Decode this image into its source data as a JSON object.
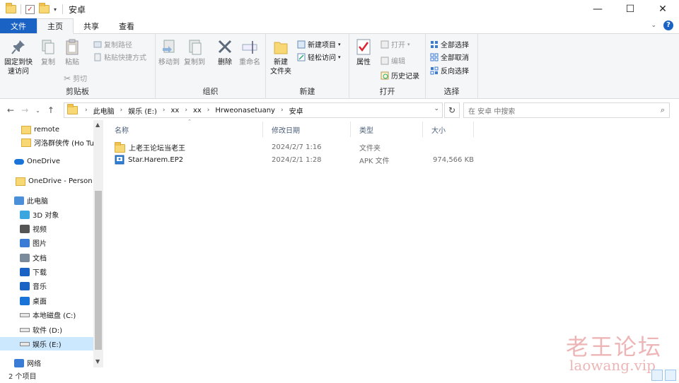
{
  "window": {
    "title": "安卓",
    "controls": {
      "minimize": "—",
      "maximize": "☐",
      "close": "✕"
    }
  },
  "tabs": [
    "文件",
    "主页",
    "共享",
    "查看"
  ],
  "ribbon": {
    "clipboard": {
      "label": "剪贴板",
      "pin": "固定到快\n速访问",
      "copy": "复制",
      "paste": "粘贴",
      "copy_path": "复制路径",
      "paste_shortcut": "粘贴快捷方式",
      "cut": "剪切"
    },
    "organize": {
      "label": "组织",
      "move_to": "移动到",
      "copy_to": "复制到",
      "delete": "删除",
      "rename": "重命名"
    },
    "new": {
      "label": "新建",
      "new_folder": "新建\n文件夹",
      "new_item": "新建项目",
      "easy_access": "轻松访问"
    },
    "open": {
      "label": "打开",
      "properties": "属性",
      "open": "打开",
      "edit": "编辑",
      "history": "历史记录"
    },
    "select": {
      "label": "选择",
      "select_all": "全部选择",
      "select_none": "全部取消",
      "invert": "反向选择"
    }
  },
  "address": {
    "crumbs": [
      "此电脑",
      "娱乐 (E:)",
      "xx",
      "xx",
      "Hrweonasetuany",
      "安卓"
    ],
    "search_placeholder": "在 安卓 中搜索"
  },
  "nav_pane": {
    "items": [
      {
        "label": "remote",
        "icon": "folder-icon"
      },
      {
        "label": "河洛群侠传 (Ho Tu",
        "icon": "folder-icon"
      },
      {
        "label": "OneDrive",
        "icon": "cloud-icon"
      },
      {
        "label": "OneDrive - Person",
        "icon": "folder-icon"
      },
      {
        "label": "此电脑",
        "icon": "computer-icon"
      },
      {
        "label": "3D 对象",
        "icon": "cube-icon"
      },
      {
        "label": "视频",
        "icon": "video-icon"
      },
      {
        "label": "图片",
        "icon": "picture-icon"
      },
      {
        "label": "文档",
        "icon": "document-icon"
      },
      {
        "label": "下载",
        "icon": "download-icon"
      },
      {
        "label": "音乐",
        "icon": "music-icon"
      },
      {
        "label": "桌面",
        "icon": "desktop-icon"
      },
      {
        "label": "本地磁盘 (C:)",
        "icon": "drive-icon"
      },
      {
        "label": "软件 (D:)",
        "icon": "drive-icon"
      },
      {
        "label": "娱乐 (E:)",
        "icon": "drive-icon",
        "selected": true
      },
      {
        "label": "网络",
        "icon": "network-icon"
      }
    ]
  },
  "columns": [
    "名称",
    "修改日期",
    "类型",
    "大小"
  ],
  "files": [
    {
      "name": "上老王论坛当老王",
      "date": "2024/2/7 1:16",
      "type": "文件夹",
      "size": "",
      "icon": "folder-icon"
    },
    {
      "name": "Star.Harem.EP2",
      "date": "2024/2/1 1:28",
      "type": "APK 文件",
      "size": "974,566 KB",
      "icon": "apk-icon"
    }
  ],
  "status": {
    "count": "2 个项目"
  },
  "watermark": {
    "cn": "老王论坛",
    "url": "laowang.vip"
  },
  "colors": {
    "accent": "#1a63c4",
    "selection": "#cce8ff",
    "folder": "#f8d775"
  }
}
